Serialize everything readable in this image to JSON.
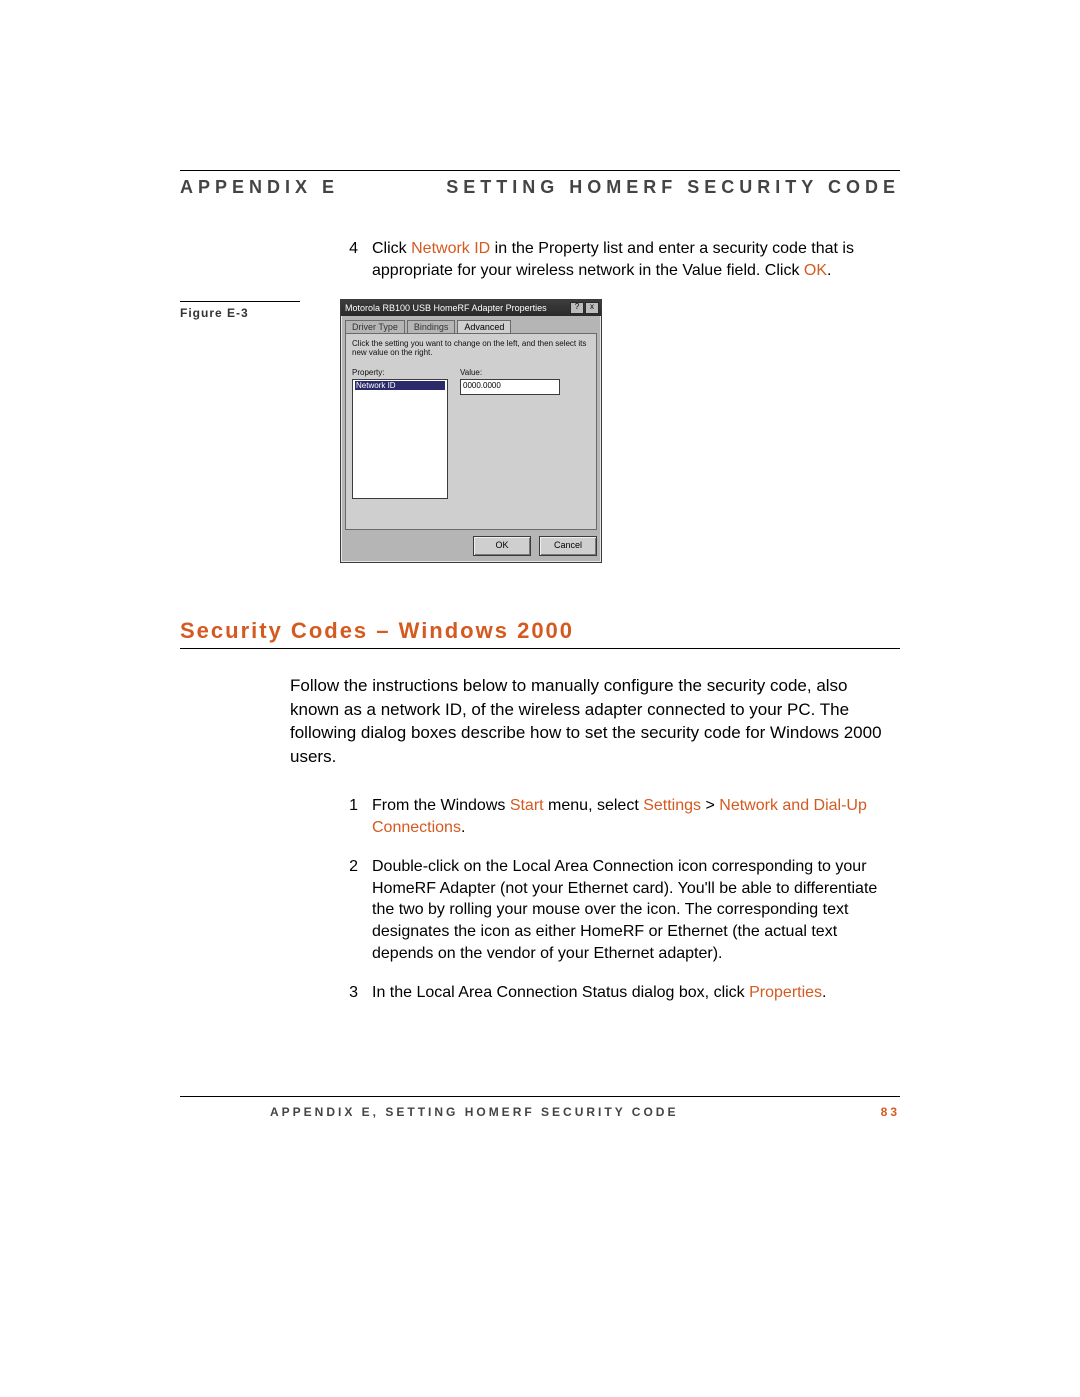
{
  "header": {
    "left": "APPENDIX E",
    "right": "SETTING HOMERF SECURITY CODE"
  },
  "step4": {
    "n": "4",
    "pre": "Click ",
    "link1": "Network ID",
    "mid": " in the Property list and enter a security code that is appropriate for your wireless network in the Value field. Click ",
    "link2": "OK",
    "post": "."
  },
  "fig": {
    "label": "Figure E-3",
    "title": "Motorola RB100 USB HomeRF Adapter Properties",
    "tabs": {
      "t1": "Driver Type",
      "t2": "Bindings",
      "t3": "Advanced"
    },
    "hint": "Click the setting you want to change on the left, and then select its new value on the right.",
    "labProperty": "Property:",
    "labValue": "Value:",
    "propSel": "Network ID",
    "value": "0000.0000",
    "ok": "OK",
    "cancel": "Cancel",
    "help": "?",
    "close": "x"
  },
  "section": {
    "title": "Security Codes – Windows 2000",
    "intro": "Follow the instructions below to manually configure the security code, also known as a network ID, of the wireless adapter connected to your PC.  The following dialog boxes describe how to set the security code for Windows 2000 users."
  },
  "steps": {
    "s1": {
      "n": "1",
      "a": "From the Windows ",
      "l1": "Start",
      "b": " menu, select ",
      "l2": "Settings",
      "c": " > ",
      "l3": "Network and Dial-Up Connections",
      "d": "."
    },
    "s2": {
      "n": "2",
      "t": "Double-click on the Local Area Connection icon corresponding to your HomeRF Adapter (not your Ethernet card).  You'll be able to differentiate the two by rolling your mouse over the icon.  The corresponding text designates the icon as either HomeRF or Ethernet (the actual text depends on the vendor of your Ethernet adapter)."
    },
    "s3": {
      "n": "3",
      "a": "In the Local Area Connection Status dialog box, click ",
      "l1": "Properties",
      "b": "."
    }
  },
  "footer": {
    "text": "APPENDIX E, SETTING HOMERF SECURITY CODE",
    "page": "83"
  }
}
